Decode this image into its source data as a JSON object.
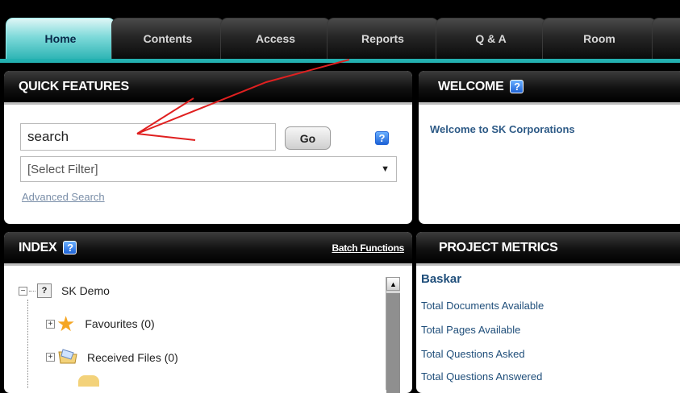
{
  "nav": {
    "tabs": [
      "Home",
      "Contents",
      "Access",
      "Reports",
      "Q & A",
      "Room"
    ],
    "active": "Home"
  },
  "quick_features": {
    "title": "QUICK FEATURES",
    "search_value": "search",
    "go_label": "Go",
    "help": "?",
    "filter_value": "[Select Filter]",
    "advanced_link": "Advanced Search"
  },
  "welcome": {
    "title": "WELCOME",
    "help": "?",
    "message": "Welcome to SK Corporations"
  },
  "index": {
    "title": "INDEX",
    "help": "?",
    "batch_link": "Batch Functions",
    "tree": [
      {
        "label": "SK Demo"
      },
      {
        "label": "Favourites (0)"
      },
      {
        "label": "Received Files (0)"
      }
    ]
  },
  "metrics": {
    "title": "PROJECT METRICS",
    "user": "Baskar",
    "items": [
      "Total Documents Available",
      "Total Pages Available",
      "Total Questions Asked",
      "Total Questions Answered"
    ]
  },
  "colors": {
    "accent": "#23b0b0",
    "link": "#2d5a86",
    "annotation": "#e02020"
  }
}
